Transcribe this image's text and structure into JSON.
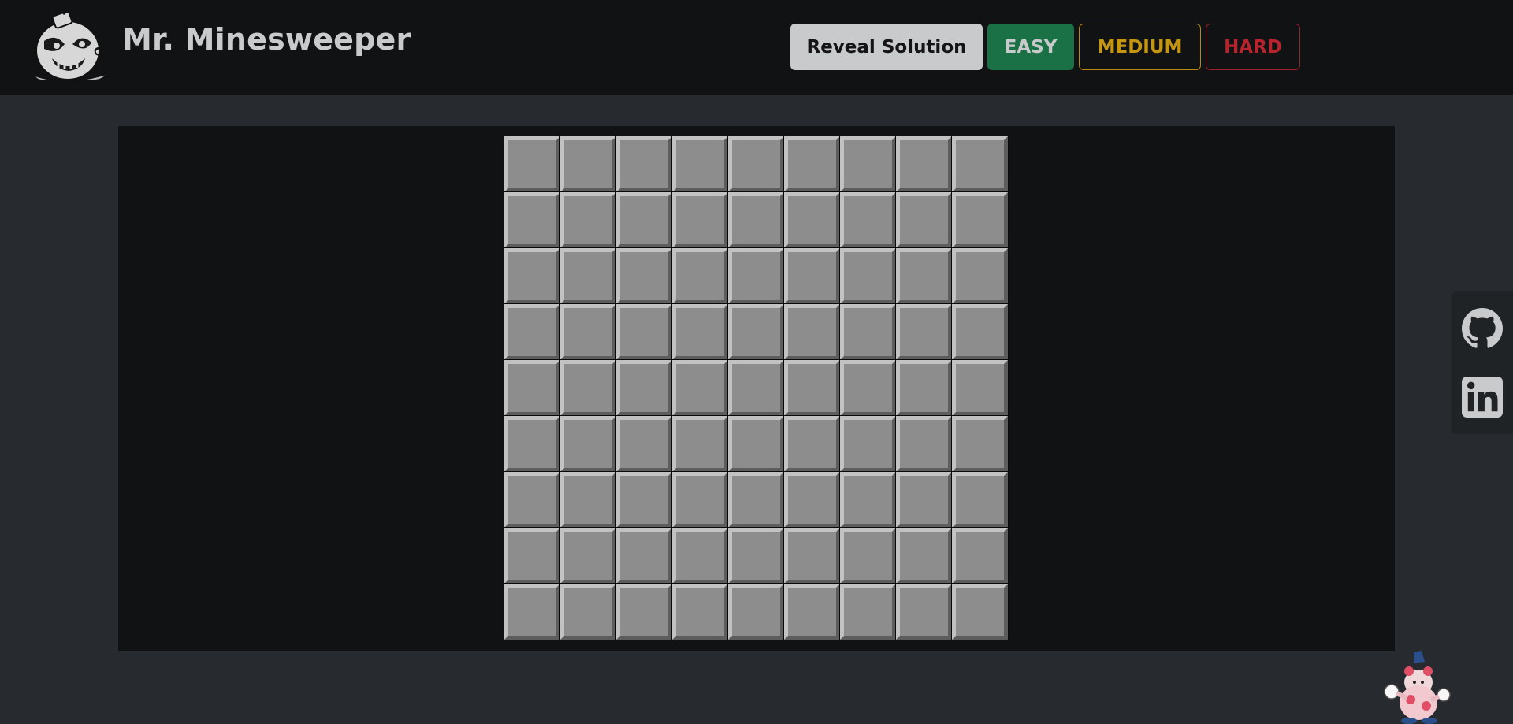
{
  "header": {
    "title": "Mr. Minesweeper",
    "logo_icon": "bomb-logo-icon",
    "buttons": {
      "reveal": "Reveal Solution",
      "easy": "EASY",
      "medium": "MEDIUM",
      "hard": "HARD"
    },
    "colors": {
      "easy": "#197145",
      "medium": "#c6960f",
      "hard": "#b8242e",
      "reveal": "#c9cacb"
    }
  },
  "board": {
    "rows": 9,
    "columns": 9,
    "cell_state": "unrevealed",
    "cell_color": "#8d8d8d"
  },
  "side_links": {
    "items": [
      {
        "icon": "github-icon"
      },
      {
        "icon": "linkedin-icon"
      }
    ]
  },
  "mascot_icon": "mr-mime-mascot-icon"
}
